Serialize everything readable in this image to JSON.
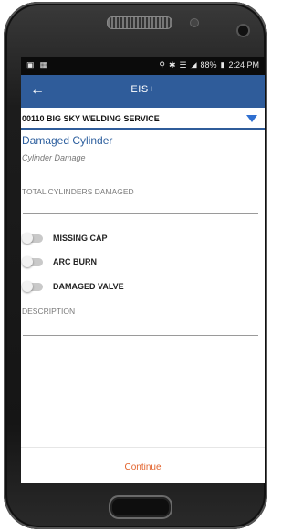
{
  "status_bar": {
    "battery": "88%",
    "time": "2:24 PM"
  },
  "app_bar": {
    "title": "EIS+",
    "back_icon": "arrow-left-icon"
  },
  "customer_select": {
    "value": "00110  BIG SKY WELDING SERVICE"
  },
  "form": {
    "heading": "Damaged Cylinder",
    "subheading": "Cylinder Damage",
    "total_label": "TOTAL CYLINDERS DAMAGED",
    "total_value": "",
    "toggles": [
      {
        "label": "MISSING CAP",
        "on": false
      },
      {
        "label": "ARC BURN",
        "on": false
      },
      {
        "label": "DAMAGED VALVE",
        "on": false
      }
    ],
    "description_label": "DESCRIPTION",
    "description_value": ""
  },
  "footer": {
    "continue_label": "Continue"
  },
  "colors": {
    "app_bar": "#2f5c9a",
    "heading": "#2d5f9e",
    "continue": "#e2622b",
    "dropdown_arrow": "#2f6fd0"
  }
}
